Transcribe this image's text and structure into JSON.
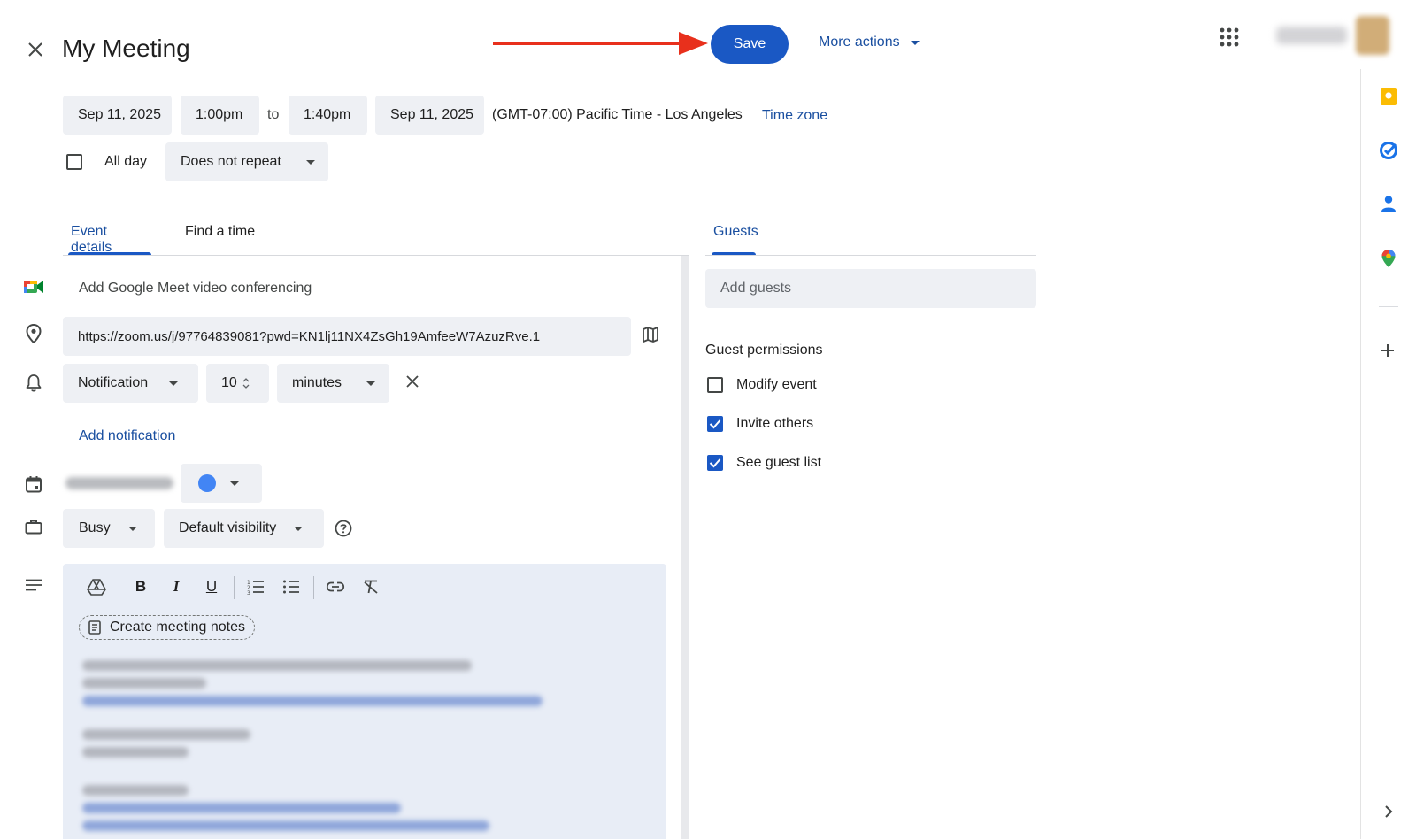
{
  "header": {
    "title": "My Meeting",
    "save_label": "Save",
    "more_actions_label": "More actions"
  },
  "datetime": {
    "start_date": "Sep 11, 2025",
    "start_time": "1:00pm",
    "to_label": "to",
    "end_time": "1:40pm",
    "end_date": "Sep 11, 2025",
    "timezone_text": "(GMT-07:00) Pacific Time - Los Angeles",
    "timezone_link": "Time zone",
    "all_day_label": "All day",
    "repeat_value": "Does not repeat"
  },
  "tabs": {
    "event_details": "Event details",
    "find_a_time": "Find a time",
    "guests": "Guests"
  },
  "details": {
    "meet_label": "Add Google Meet video conferencing",
    "location_value": "https://zoom.us/j/97764839081?pwd=KN1lj11NX4ZsGh19AmfeeW7AzuzRve.1",
    "notification_type": "Notification",
    "notification_amount": "10",
    "notification_unit": "minutes",
    "add_notification": "Add notification",
    "calendar_color": "#4285f4",
    "availability": "Busy",
    "visibility": "Default visibility",
    "create_notes": "Create meeting notes"
  },
  "guests": {
    "add_placeholder": "Add guests",
    "permissions_label": "Guest permissions",
    "permissions": [
      {
        "label": "Modify event",
        "checked": false
      },
      {
        "label": "Invite others",
        "checked": true
      },
      {
        "label": "See guest list",
        "checked": true
      }
    ]
  },
  "side_panel": {
    "icons": [
      "keep-icon",
      "tasks-icon",
      "contacts-icon",
      "maps-icon",
      "add-icon",
      "chevron-right-icon"
    ]
  },
  "colors": {
    "accent": "#1a58c4",
    "link": "#1a4fa0",
    "field_bg": "#eef0f4",
    "annotation_arrow": "#e8301c"
  }
}
